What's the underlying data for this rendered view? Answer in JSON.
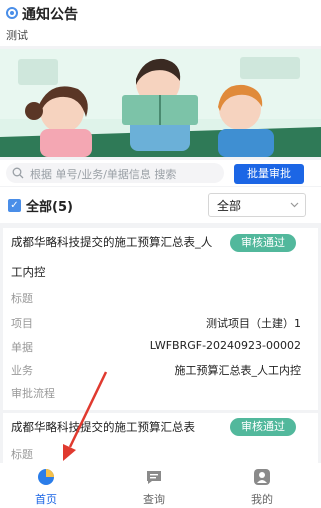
{
  "notice": {
    "title": "通知公告",
    "subtitle": "测试"
  },
  "search": {
    "placeholder": "根据 单号/业务/单据信息 搜索",
    "batch_label": "批量审批"
  },
  "filter": {
    "all_count": "全部(5)",
    "select_value": "全部"
  },
  "cards": [
    {
      "title": "成都华略科技提交的施工预算汇总表_人",
      "title_cont": "工内控",
      "status": "审核通过",
      "rows": [
        {
          "label": "标题",
          "value": ""
        },
        {
          "label": "项目",
          "value": "测试项目（土建）1"
        },
        {
          "label": "单据",
          "value": "LWFBRGF-20240923-00002"
        },
        {
          "label": "业务",
          "value": "施工预算汇总表_人工内控"
        },
        {
          "label": "审批流程",
          "value": ""
        }
      ]
    },
    {
      "title": "成都华略科技提交的施工预算汇总表",
      "status": "审核通过",
      "rows": [
        {
          "label": "标题",
          "value": ""
        }
      ]
    }
  ],
  "tabs": [
    {
      "label": "首页",
      "icon": "pie-chart-icon",
      "active": true
    },
    {
      "label": "查询",
      "icon": "chat-bubble-icon",
      "active": false
    },
    {
      "label": "我的",
      "icon": "user-icon",
      "active": false
    }
  ],
  "colors": {
    "primary": "#1c66e5",
    "status_green": "#52b89c",
    "annotation_arrow": "#e03a2f"
  }
}
